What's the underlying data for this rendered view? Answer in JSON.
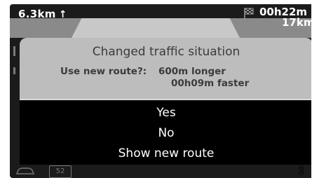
{
  "topbar": {
    "distance": "6.3km",
    "distance_arrow": "↑",
    "flag_icon": "checkered-flag-icon",
    "eta_line1": "00h22m",
    "eta_line2": "17km"
  },
  "dialog": {
    "title": "Changed traffic situation",
    "question": "Use new route?:",
    "detail_line1": "600m longer",
    "detail_line2": "00h09m faster"
  },
  "options": [
    {
      "label": "Yes"
    },
    {
      "label": "No"
    },
    {
      "label": "Show new route"
    }
  ],
  "bottombar": {
    "car_icon": "car-icon",
    "badge_text": "52"
  },
  "figure_code": "G037262"
}
